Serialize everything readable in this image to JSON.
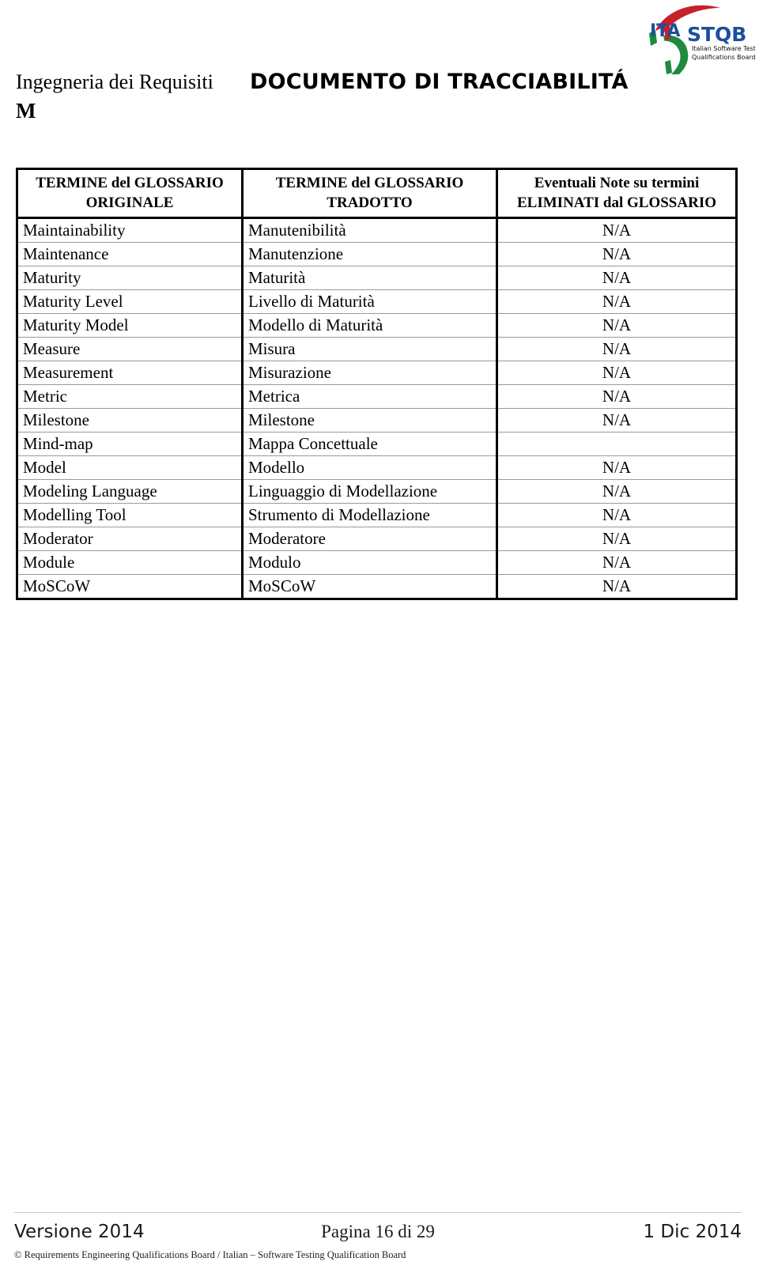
{
  "header": {
    "chapter_title": "Ingegneria dei Requisiti",
    "document_title": "DOCUMENTO DI TRACCIABILITÁ",
    "chapter_letter": "M",
    "logo": {
      "primary": "ITA",
      "secondary": "STQB",
      "subtitle_line1": "Italian Software Testing",
      "subtitle_line2": "Qualifications Board",
      "colors": {
        "blue": "#1b4f9c",
        "red": "#c8202a",
        "green": "#1d8a3f",
        "dark": "#111111"
      }
    }
  },
  "table": {
    "columns": [
      {
        "line1": "TERMINE del GLOSSARIO",
        "line2": "ORIGINALE"
      },
      {
        "line1": "TERMINE del GLOSSARIO",
        "line2": "TRADOTTO"
      },
      {
        "line1": "Eventuali Note su termini",
        "line2": "ELIMINATI dal GLOSSARIO"
      }
    ],
    "rows": [
      {
        "original": "Maintainability",
        "translated": "Manutenibilità",
        "note": "N/A"
      },
      {
        "original": "Maintenance",
        "translated": "Manutenzione",
        "note": "N/A"
      },
      {
        "original": "Maturity",
        "translated": "Maturità",
        "note": "N/A"
      },
      {
        "original": "Maturity Level",
        "translated": "Livello di Maturità",
        "note": "N/A"
      },
      {
        "original": "Maturity Model",
        "translated": "Modello di Maturità",
        "note": "N/A"
      },
      {
        "original": "Measure",
        "translated": "Misura",
        "note": "N/A"
      },
      {
        "original": "Measurement",
        "translated": "Misurazione",
        "note": "N/A"
      },
      {
        "original": "Metric",
        "translated": "Metrica",
        "note": "N/A"
      },
      {
        "original": "Milestone",
        "translated": "Milestone",
        "note": "N/A"
      },
      {
        "original": "Mind-map",
        "translated": "Mappa Concettuale",
        "note": ""
      },
      {
        "original": "Model",
        "translated": "Modello",
        "note": "N/A"
      },
      {
        "original": "Modeling Language",
        "translated": "Linguaggio di Modellazione",
        "note": "N/A"
      },
      {
        "original": "Modelling Tool",
        "translated": "Strumento di Modellazione",
        "note": "N/A"
      },
      {
        "original": "Moderator",
        "translated": "Moderatore",
        "note": "N/A"
      },
      {
        "original": "Module",
        "translated": "Modulo",
        "note": "N/A"
      },
      {
        "original": "MoSCoW",
        "translated": "MoSCoW",
        "note": "N/A"
      }
    ]
  },
  "footer": {
    "version": "Versione 2014",
    "page": "Pagina 16 di 29",
    "date": "1 Dic 2014",
    "copyright": "© Requirements Engineering Qualifications Board / Italian – Software Testing Qualification Board"
  }
}
